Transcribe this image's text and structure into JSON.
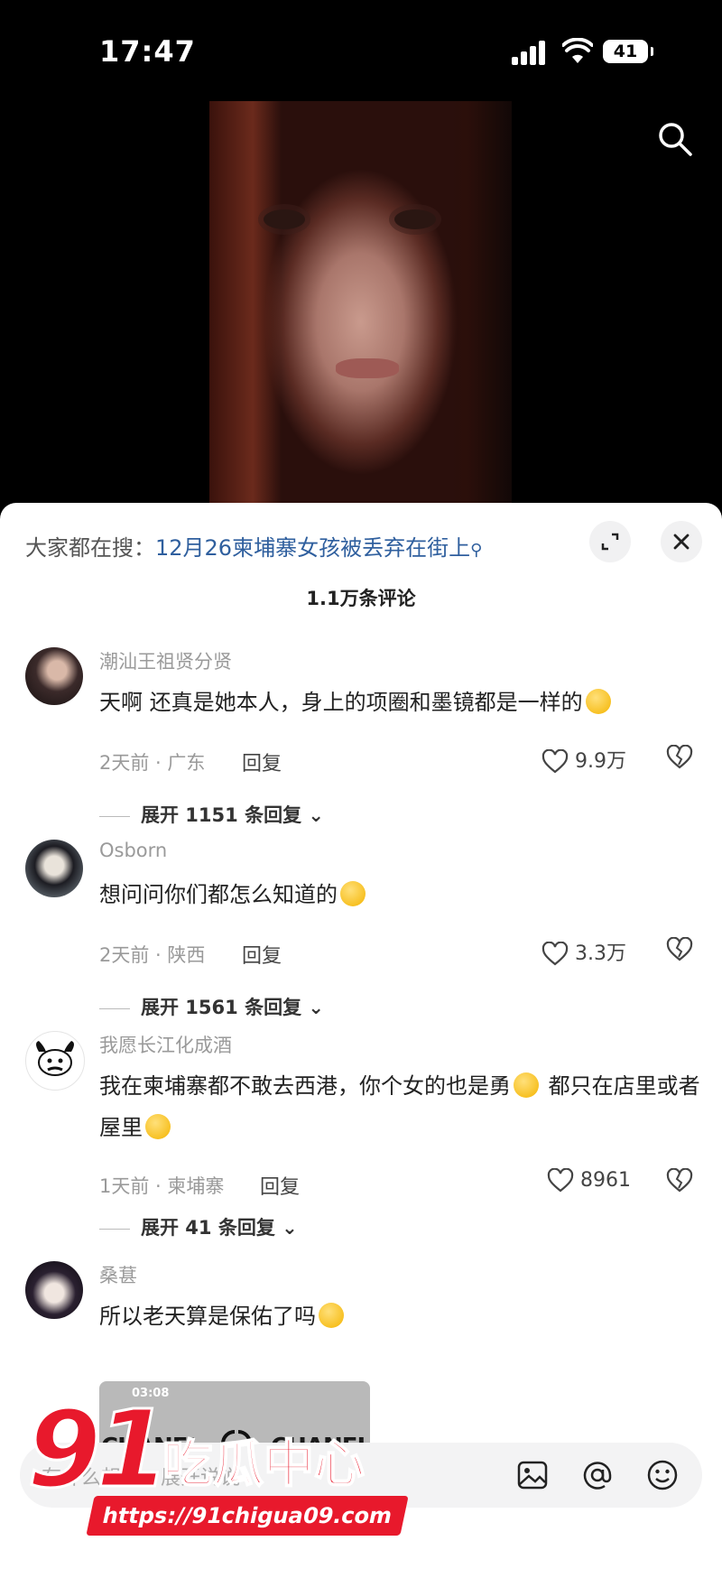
{
  "status_bar": {
    "time": "17:47",
    "battery": "41"
  },
  "panel": {
    "trending_prefix": "大家都在搜：",
    "trending_keyword": "12月26柬埔寨女孩被丢弃在街上",
    "comment_count": "1.1万条评论"
  },
  "comments": [
    {
      "username": "潮汕王祖贤分贤",
      "text": "天啊 还真是她本人，身上的项圈和墨镜都是一样的",
      "meta": "2天前 · 广东",
      "reply_label": "回复",
      "likes": "9.9万",
      "expand": "展开 1151 条回复"
    },
    {
      "username": "Osborn",
      "text": "想问问你们都怎么知道的",
      "meta": "2天前 · 陕西",
      "reply_label": "回复",
      "likes": "3.3万",
      "expand": "展开 1561 条回复"
    },
    {
      "username": "我愿长江化成酒",
      "text_a": "我在柬埔寨都不敢去西港，你个女的也是勇",
      "text_b": " 都只在店里或者屋里",
      "meta": "1天前 · 柬埔寨",
      "reply_label": "回复",
      "likes": "8961",
      "expand": "展开 41 条回复"
    },
    {
      "username": "桑葚",
      "text": "所以老天算是保佑了吗",
      "thumb_time": "03:08",
      "thumb_brand": "CHANEL"
    }
  ],
  "input": {
    "placeholder": "有什么想法，展开说说"
  },
  "watermark": {
    "number": "91",
    "name": "吃瓜中心",
    "url": "https://91chigua09.com"
  },
  "colors": {
    "accent_link": "#2f5f9e",
    "watermark_red": "#e8192c"
  }
}
